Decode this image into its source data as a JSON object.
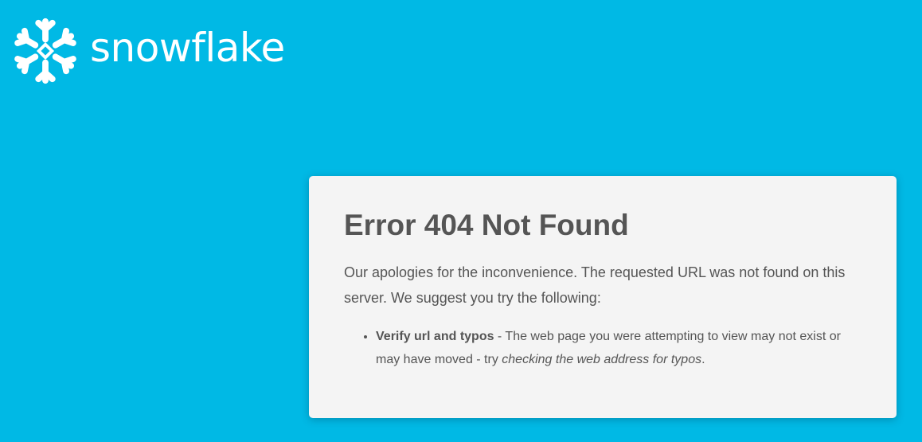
{
  "logo": {
    "icon": "snowflake-icon",
    "wordmark": "snowflake"
  },
  "colors": {
    "background": "#00b9e5",
    "card": "#f4f4f4",
    "text": "#555555",
    "logo": "#ffffff"
  },
  "error": {
    "title": "Error 404 Not Found",
    "intro": "Our apologies for the inconvenience. The requested URL was not found on this server. We suggest you try the following:",
    "suggestions": [
      {
        "heading": "Verify url and typos",
        "text": " - The web page you were attempting to view may not exist or may have moved - try ",
        "emphasis": "checking the web address for typos",
        "end": "."
      }
    ]
  }
}
